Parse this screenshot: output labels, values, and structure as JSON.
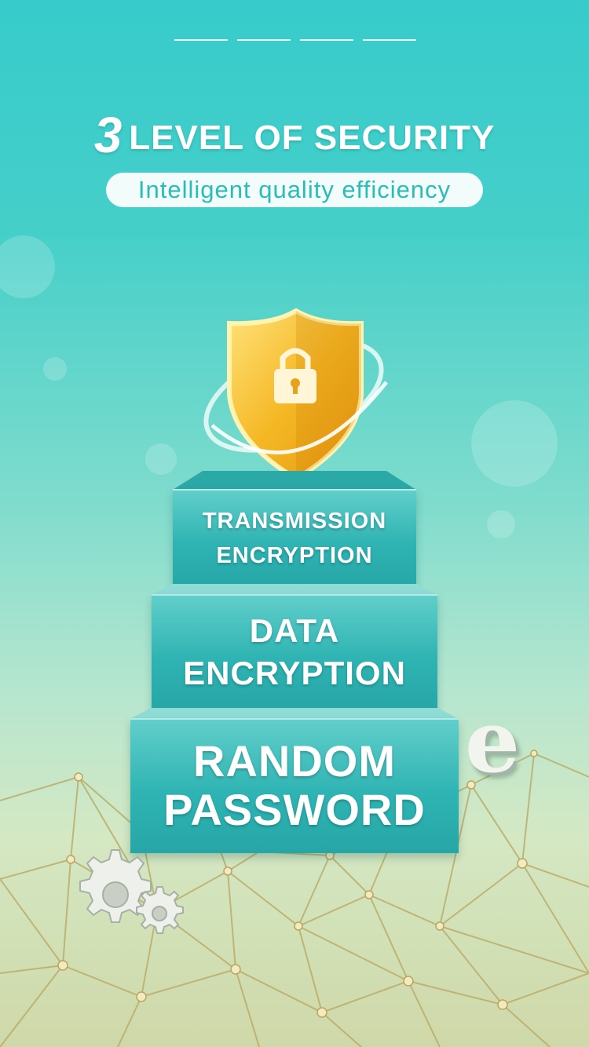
{
  "pager": {
    "pages": 4
  },
  "header": {
    "title_number": "3",
    "title_text": "LEVEL OF SECURITY",
    "subtitle": "Intelligent quality efficiency"
  },
  "steps": [
    {
      "line1": "TRANSMISSION",
      "line2": "ENCRYPTION"
    },
    {
      "line1": "DATA",
      "line2": "ENCRYPTION"
    },
    {
      "line1": "RANDOM",
      "line2": "PASSWORD"
    }
  ],
  "icons": {
    "shield": "shield-lock-icon",
    "gear": "gear-icon",
    "letter": "e-letter-icon",
    "letter_glyph": "e"
  },
  "colors": {
    "accent": "#2bbcb8",
    "shield_gold": "#f2b21c",
    "step_teal": "#2fb4b3"
  }
}
